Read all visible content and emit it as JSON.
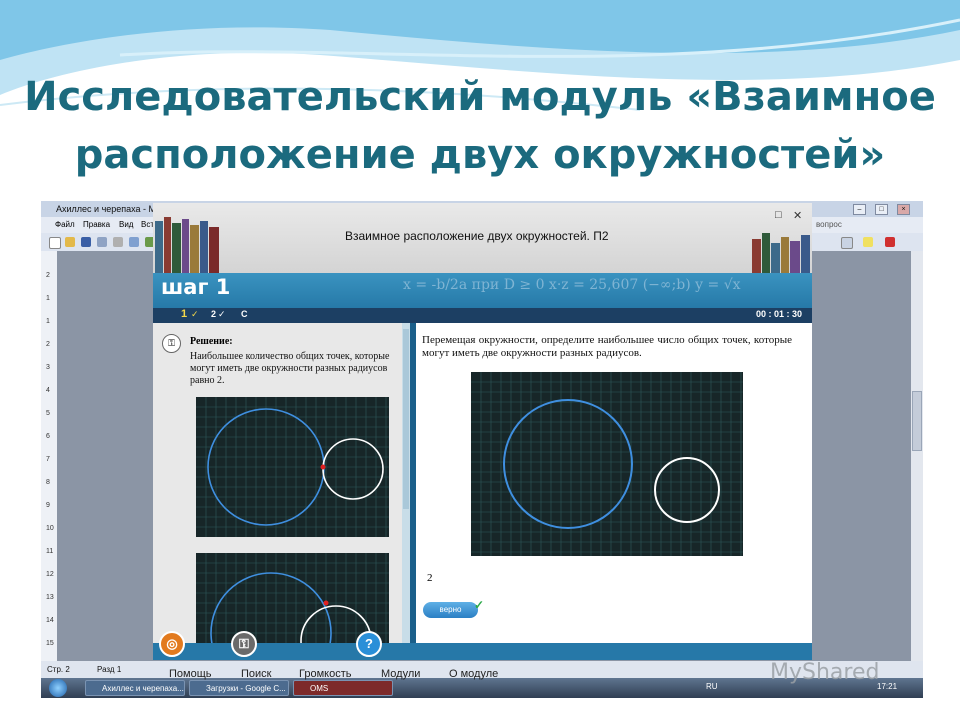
{
  "slide": {
    "title_line1": "Исследовательский модуль «Взаимное",
    "title_line2": "расположение двух окружностей»"
  },
  "word_window": {
    "title": "Ахиллес и черепаха - Micro",
    "menu": [
      "Файл",
      "Правка",
      "Вид",
      "Вст"
    ],
    "help_box": "вопрос",
    "status_page": "Стр. 2",
    "status_section": "Разд 1",
    "ruler_numbers": [
      "2",
      "1",
      "1",
      "2",
      "3",
      "4",
      "5",
      "6",
      "7",
      "8",
      "9",
      "10",
      "11",
      "12",
      "13",
      "14",
      "15"
    ]
  },
  "taskbar": {
    "items": [
      "Ахиллес и черепаха...",
      "Загрузки - Google C...",
      "OMS"
    ],
    "lang": "RU",
    "clock": "17:21"
  },
  "app": {
    "title": "Взаимное расположение двух окружностей. П2",
    "step": "шаг 1",
    "formula_bg": "x = -b/2a   при D ≥ 0   x·z = 25,607   (−∞;b)   y = √x",
    "nav": {
      "item1": "1",
      "item2": "2",
      "item3": "С",
      "timer": "00 : 01 : 30"
    },
    "solution_heading": "Решение:",
    "solution_text": "Наибольшее количество общих точек, которые могут иметь две окружности разных радиусов равно 2.",
    "task_text": "Перемещая окружности, определите наибольшее число общих точек, которые могут иметь две окружности разных радиусов.",
    "answer": "2",
    "check_button": "верно",
    "help_button": "?",
    "bottom_menu": [
      "Помощь",
      "Поиск",
      "Громкость",
      "Модули",
      "О модуле"
    ]
  },
  "watermark": "MyShared",
  "colors": {
    "title": "#1b6a7e",
    "step_bar": "#2d84b4",
    "grid_bg": "#172628",
    "blue_circle": "#3f8fe0",
    "white_circle": "#ffffff"
  }
}
